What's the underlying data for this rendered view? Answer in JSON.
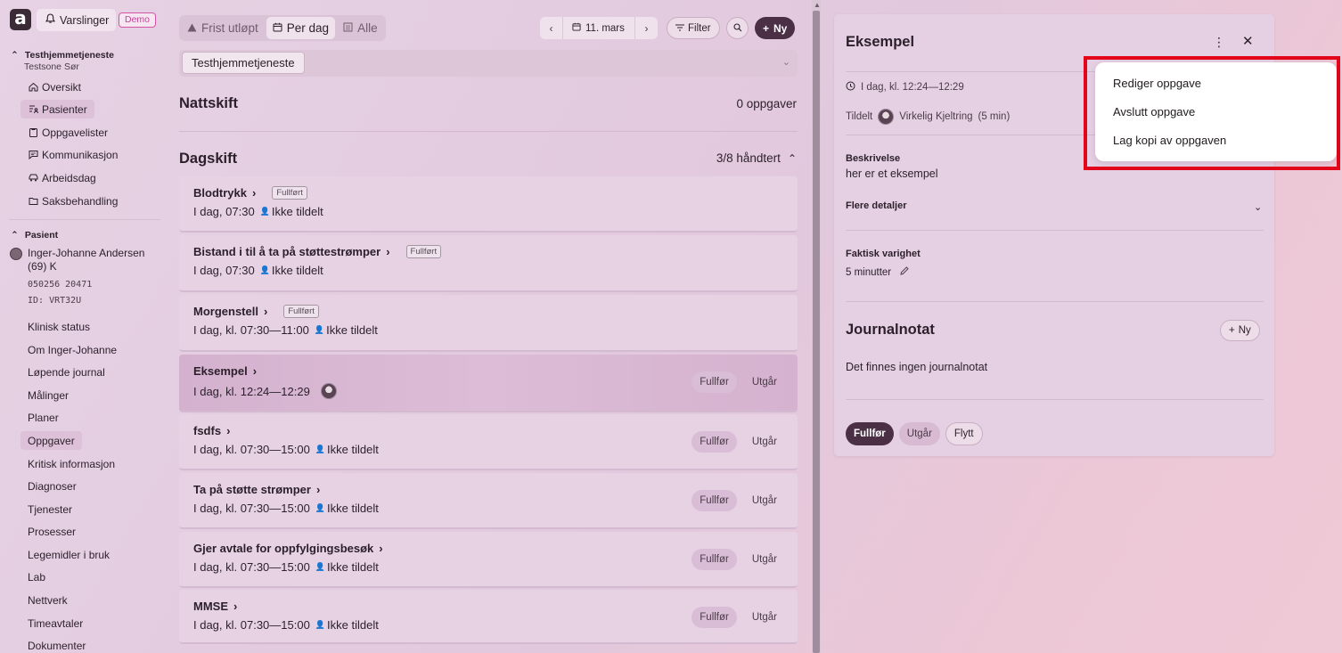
{
  "header": {
    "logo_letter": "a",
    "notifications_label": "Varslinger",
    "demo_badge": "Demo"
  },
  "sidebar": {
    "org_title": "Testhjemmetjeneste",
    "org_sub": "Testsone Sør",
    "org_items": [
      {
        "label": "Oversikt",
        "icon": "home-icon"
      },
      {
        "label": "Pasienter",
        "icon": "people-list-icon"
      },
      {
        "label": "Oppgavelister",
        "icon": "clipboard-icon"
      },
      {
        "label": "Kommunikasjon",
        "icon": "message-icon"
      },
      {
        "label": "Arbeidsdag",
        "icon": "car-icon"
      },
      {
        "label": "Saksbehandling",
        "icon": "folder-icon"
      }
    ],
    "patient_section": "Pasient",
    "patient_name": "Inger-Johanne Andersen (69) K",
    "patient_ssn": "050256 20471",
    "patient_id": "ID: VRT32U",
    "patient_items": [
      "Klinisk status",
      "Om Inger-Johanne",
      "Løpende journal",
      "Målinger",
      "Planer",
      "Oppgaver",
      "Kritisk informasjon",
      "Diagnoser",
      "Tjenester",
      "Prosesser",
      "Legemidler i bruk",
      "Lab",
      "Nettverk",
      "Timeavtaler",
      "Dokumenter"
    ],
    "active_patient_item": "Oppgaver"
  },
  "toolbar": {
    "tabs": [
      {
        "label": "Frist utløpt",
        "icon": "warning-icon"
      },
      {
        "label": "Per dag",
        "icon": "calendar-icon"
      },
      {
        "label": "Alle",
        "icon": "list-icon"
      }
    ],
    "active_tab": "Per dag",
    "date": "11. mars",
    "filter_label": "Filter",
    "new_label": "Ny",
    "org_chip": "Testhjemmetjeneste"
  },
  "shifts": {
    "night": {
      "title": "Nattskift",
      "count": "0 oppgaver"
    },
    "day": {
      "title": "Dagskift",
      "count": "3/8 håndtert"
    }
  },
  "tasks": [
    {
      "title": "Blodtrykk",
      "badge": "Fullført",
      "time": "I dag, 07:30",
      "assignee": "Ikke tildelt",
      "actions": false
    },
    {
      "title": "Bistand i til å ta på støttestrømper",
      "badge": "Fullført",
      "time": "I dag, 07:30",
      "assignee": "Ikke tildelt",
      "actions": false
    },
    {
      "title": "Morgenstell",
      "badge": "Fullført",
      "time": "I dag, kl. 07:30—11:00",
      "assignee": "Ikke tildelt",
      "actions": false
    },
    {
      "title": "Eksempel",
      "badge": "",
      "time": "I dag, kl. 12:24—12:29",
      "assignee": "",
      "actions": true
    },
    {
      "title": "fsdfs",
      "badge": "",
      "time": "I dag, kl. 07:30—15:00",
      "assignee": "Ikke tildelt",
      "actions": true
    },
    {
      "title": "Ta på støtte strømper",
      "badge": "",
      "time": "I dag, kl. 07:30—15:00",
      "assignee": "Ikke tildelt",
      "actions": true
    },
    {
      "title": "Gjer avtale for oppfylgingsbesøk",
      "badge": "",
      "time": "I dag, kl. 07:30—15:00",
      "assignee": "Ikke tildelt",
      "actions": true
    },
    {
      "title": "MMSE",
      "badge": "",
      "time": "I dag, kl. 07:30—15:00",
      "assignee": "Ikke tildelt",
      "actions": true
    }
  ],
  "task_actions": {
    "complete": "Fullfør",
    "expire": "Utgår"
  },
  "detail": {
    "title": "Eksempel",
    "time": "I dag, kl. 12:24—12:29",
    "assigned_label": "Tildelt",
    "assignee": "Virkelig Kjeltring",
    "assignee_duration": "(5 min)",
    "description_label": "Beskrivelse",
    "description": "her er et eksempel",
    "more_details_label": "Flere detaljer",
    "actual_duration_label": "Faktisk varighet",
    "actual_duration": "5 minutter",
    "journal_title": "Journalnotat",
    "journal_new": "Ny",
    "journal_empty": "Det finnes ingen journalnotat",
    "btn_complete": "Fullfør",
    "btn_expire": "Utgår",
    "btn_move": "Flytt"
  },
  "context_menu": {
    "items": [
      "Rediger oppgave",
      "Avslutt oppgave",
      "Lag kopi av oppgaven"
    ]
  },
  "colors": {
    "highlight_border": "#e3061a",
    "primary": "#4a2f45",
    "demo_badge": "#c24597"
  }
}
